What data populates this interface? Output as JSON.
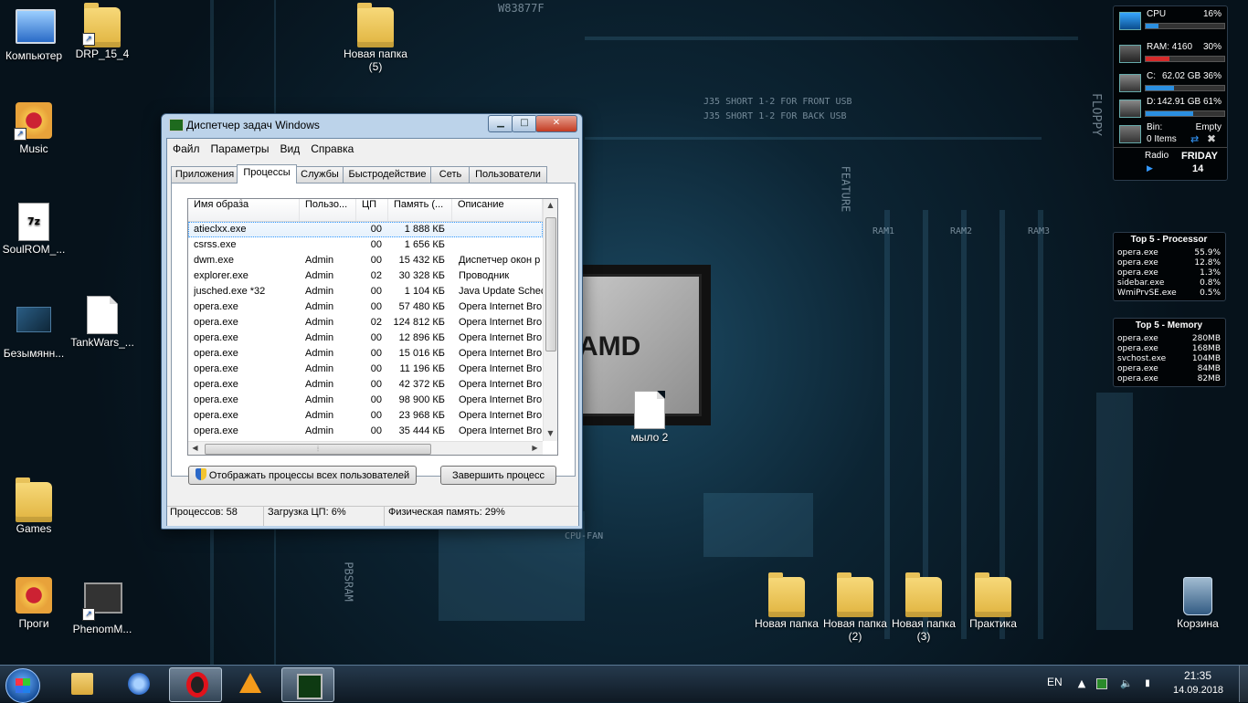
{
  "wallpaper": {
    "chip_brand": "AMD",
    "labels": [
      "W83877F",
      "J35 SHORT 1-2 FOR FRONT USB",
      "J35 SHORT 1-2 FOR BACK USB",
      "FLOPPY",
      "FEATURE",
      "CPU-FAN",
      "PBSRAM",
      "RAM1",
      "RAM2",
      "RAM3"
    ]
  },
  "desktop_icons": [
    {
      "id": "computer",
      "label": "Компьютер",
      "icon": "computer-icon"
    },
    {
      "id": "drp",
      "label": "DRP_15_4",
      "icon": "folder-shortcut-icon"
    },
    {
      "id": "new-folder-5",
      "label": "Новая папка (5)",
      "icon": "folder-icon"
    },
    {
      "id": "music",
      "label": "Music",
      "icon": "music-folder-icon"
    },
    {
      "id": "soulrom",
      "label": "SoulROM_...",
      "icon": "7zip-archive-icon"
    },
    {
      "id": "bezymyann",
      "label": "Безымянн...",
      "icon": "image-file-icon"
    },
    {
      "id": "tankwars",
      "label": "TankWars_...",
      "icon": "file-icon"
    },
    {
      "id": "games",
      "label": "Games",
      "icon": "folder-icon"
    },
    {
      "id": "progi",
      "label": "Проги",
      "icon": "folder-icon"
    },
    {
      "id": "phenom",
      "label": "PhenomM...",
      "icon": "chip-shortcut-icon"
    },
    {
      "id": "mylo2",
      "label": "мыло 2",
      "icon": "file-icon"
    },
    {
      "id": "new-folder",
      "label": "Новая папка",
      "icon": "folder-icon"
    },
    {
      "id": "new-folder-2",
      "label": "Новая папка (2)",
      "icon": "folder-icon"
    },
    {
      "id": "new-folder-3",
      "label": "Новая папка (3)",
      "icon": "folder-icon"
    },
    {
      "id": "praktika",
      "label": "Практика",
      "icon": "folder-icon"
    },
    {
      "id": "recycle",
      "label": "Корзина",
      "icon": "recycle-bin-icon"
    }
  ],
  "taskmgr": {
    "title": "Диспетчер задач Windows",
    "buttons": {
      "minimize": "▁",
      "maximize": "□",
      "close": "✕"
    },
    "menu": [
      "Файл",
      "Параметры",
      "Вид",
      "Справка"
    ],
    "tabs": [
      "Приложения",
      "Процессы",
      "Службы",
      "Быстродействие",
      "Сеть",
      "Пользователи"
    ],
    "active_tab": "Процессы",
    "columns": [
      "Имя образа",
      "Пользо...",
      "ЦП",
      "Память (...",
      "Описание"
    ],
    "sort_indicator": "^",
    "rows": [
      {
        "name": "atieclxx.exe",
        "user": "",
        "cpu": "00",
        "mem": "1 888 КБ",
        "desc": ""
      },
      {
        "name": "csrss.exe",
        "user": "",
        "cpu": "00",
        "mem": "1 656 КБ",
        "desc": ""
      },
      {
        "name": "dwm.exe",
        "user": "Admin",
        "cpu": "00",
        "mem": "15 432 КБ",
        "desc": "Диспетчер окон р"
      },
      {
        "name": "explorer.exe",
        "user": "Admin",
        "cpu": "02",
        "mem": "30 328 КБ",
        "desc": "Проводник"
      },
      {
        "name": "jusched.exe *32",
        "user": "Admin",
        "cpu": "00",
        "mem": "1 104 КБ",
        "desc": "Java Update Schec"
      },
      {
        "name": "opera.exe",
        "user": "Admin",
        "cpu": "00",
        "mem": "57 480 КБ",
        "desc": "Opera Internet Bro"
      },
      {
        "name": "opera.exe",
        "user": "Admin",
        "cpu": "02",
        "mem": "124 812 КБ",
        "desc": "Opera Internet Bro"
      },
      {
        "name": "opera.exe",
        "user": "Admin",
        "cpu": "00",
        "mem": "12 896 КБ",
        "desc": "Opera Internet Bro"
      },
      {
        "name": "opera.exe",
        "user": "Admin",
        "cpu": "00",
        "mem": "15 016 КБ",
        "desc": "Opera Internet Bro"
      },
      {
        "name": "opera.exe",
        "user": "Admin",
        "cpu": "00",
        "mem": "11 196 КБ",
        "desc": "Opera Internet Bro"
      },
      {
        "name": "opera.exe",
        "user": "Admin",
        "cpu": "00",
        "mem": "42 372 КБ",
        "desc": "Opera Internet Bro"
      },
      {
        "name": "opera.exe",
        "user": "Admin",
        "cpu": "00",
        "mem": "98 900 КБ",
        "desc": "Opera Internet Bro"
      },
      {
        "name": "opera.exe",
        "user": "Admin",
        "cpu": "00",
        "mem": "23 968 КБ",
        "desc": "Opera Internet Bro"
      },
      {
        "name": "opera.exe",
        "user": "Admin",
        "cpu": "00",
        "mem": "35 444 КБ",
        "desc": "Opera Internet Bro"
      }
    ],
    "show_all_button": "Отображать процессы всех пользователей",
    "end_process_button": "Завершить процесс",
    "status": {
      "processes": "Процессов: 58",
      "cpu": "Загрузка ЦП: 6%",
      "memory": "Физическая память: 29%"
    }
  },
  "monitor_gadget": {
    "cpu": {
      "label": "CPU",
      "value": "16%",
      "level": 16,
      "color": "#2b8fe0"
    },
    "ram": {
      "label": "RAM: 4160",
      "value": "30%",
      "level": 30,
      "color": "#d62b2b"
    },
    "disk_c": {
      "label": "C:",
      "value": "62.02 GB 36%",
      "level": 36,
      "color": "#2b8fe0"
    },
    "disk_d": {
      "label": "D:",
      "value": "142.91 GB 61%",
      "level": 61,
      "color": "#2b8fe0"
    },
    "bin": {
      "label": "Bin:",
      "status": "Empty",
      "items": "0 Items"
    },
    "radio": "Radio",
    "day": "FRIDAY",
    "date": "14"
  },
  "top5_processor": {
    "title": "Top 5 - Processor",
    "rows": [
      {
        "name": "opera.exe",
        "value": "55.9%"
      },
      {
        "name": "opera.exe",
        "value": "12.8%"
      },
      {
        "name": "opera.exe",
        "value": "1.3%"
      },
      {
        "name": "sidebar.exe",
        "value": "0.8%"
      },
      {
        "name": "WmiPrvSE.exe",
        "value": "0.5%"
      }
    ]
  },
  "top5_memory": {
    "title": "Top 5 - Memory",
    "rows": [
      {
        "name": "opera.exe",
        "value": "280MB"
      },
      {
        "name": "opera.exe",
        "value": "168MB"
      },
      {
        "name": "svchost.exe",
        "value": "104MB"
      },
      {
        "name": "opera.exe",
        "value": "84MB"
      },
      {
        "name": "opera.exe",
        "value": "82MB"
      }
    ]
  },
  "taskbar": {
    "pinned": [
      {
        "name": "explorer-icon"
      },
      {
        "name": "thunderbird-icon"
      },
      {
        "name": "opera-icon"
      },
      {
        "name": "aimp-icon"
      },
      {
        "name": "task-manager-icon"
      }
    ],
    "lang": "EN",
    "time": "21:35",
    "date": "14.09.2018"
  }
}
